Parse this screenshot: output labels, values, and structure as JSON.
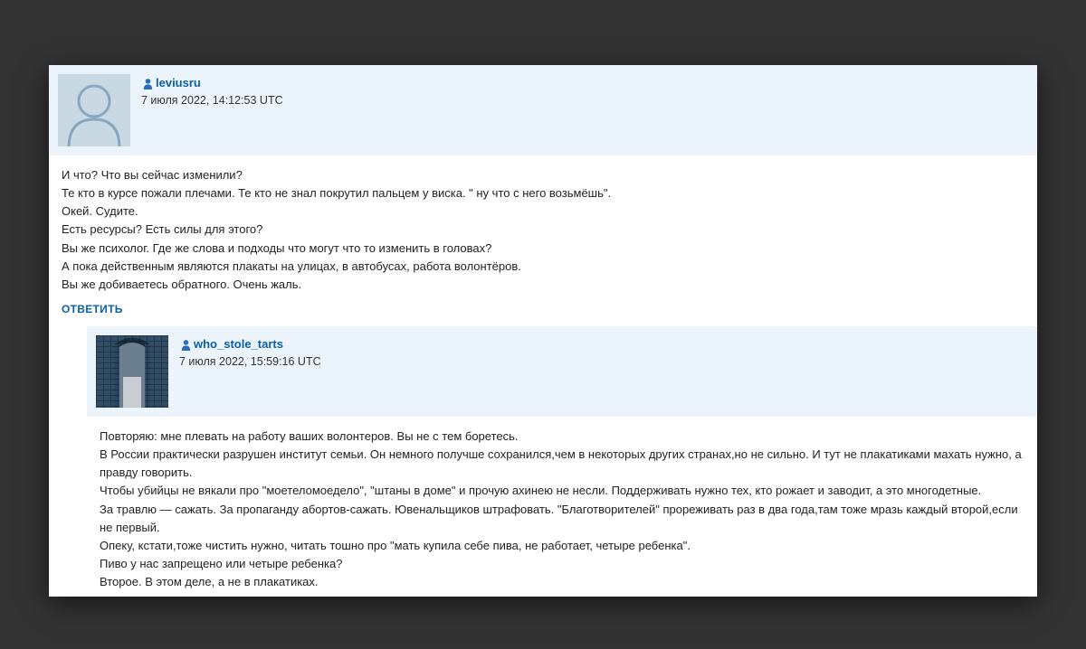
{
  "comments": [
    {
      "username": "leviusru",
      "timestamp": "7 июля 2022, 14:12:53 UTC",
      "body_lines": [
        "И что? Что вы сейчас изменили?",
        "Те кто в курсе пожали плечами. Те кто не знал покрутил пальцем у виска. \" ну что с него возьмёшь\".",
        "Окей. Судите.",
        "Есть ресурсы? Есть силы для этого?",
        "Вы же психолог. Где же слова и подходы что могут что то изменить в головах?",
        "А пока действенным являются плакаты на улицах, в автобусах, работа волонтёров.",
        "Вы же добиваетесь обратного. Очень жаль."
      ],
      "reply_label": "ОТВЕТИТЬ"
    },
    {
      "username": "who_stole_tarts",
      "timestamp": "7 июля 2022, 15:59:16 UTC",
      "body_lines": [
        "Повторяю: мне плевать на работу ваших волонтеров. Вы не с тем боретесь.",
        "В России практически разрушен институт семьи. Он немного получше сохранился,чем в некоторых других странах,но не сильно. И тут не плакатиками махать нужно, а правду говорить.",
        "Чтобы убийцы не вякали про \"моетеломоедело\", \"штаны в доме\" и прочую ахинею не несли. Поддерживать нужно тех, кто рожает и заводит, а это многодетные.",
        "За травлю — сажать. За пропаганду абортов-сажать. Ювенальщиков штрафовать. \"Благотворителей\" прореживать раз в два года,там тоже мразь каждый второй,если не первый.",
        "Опеку, кстати,тоже чистить нужно, читать тошно про \"мать купила себе пива, не работает, четыре ребенка\".",
        "Пиво у нас запрещено или четыре ребенка?",
        "Второе. В этом деле, а не в плакатиках."
      ]
    }
  ]
}
